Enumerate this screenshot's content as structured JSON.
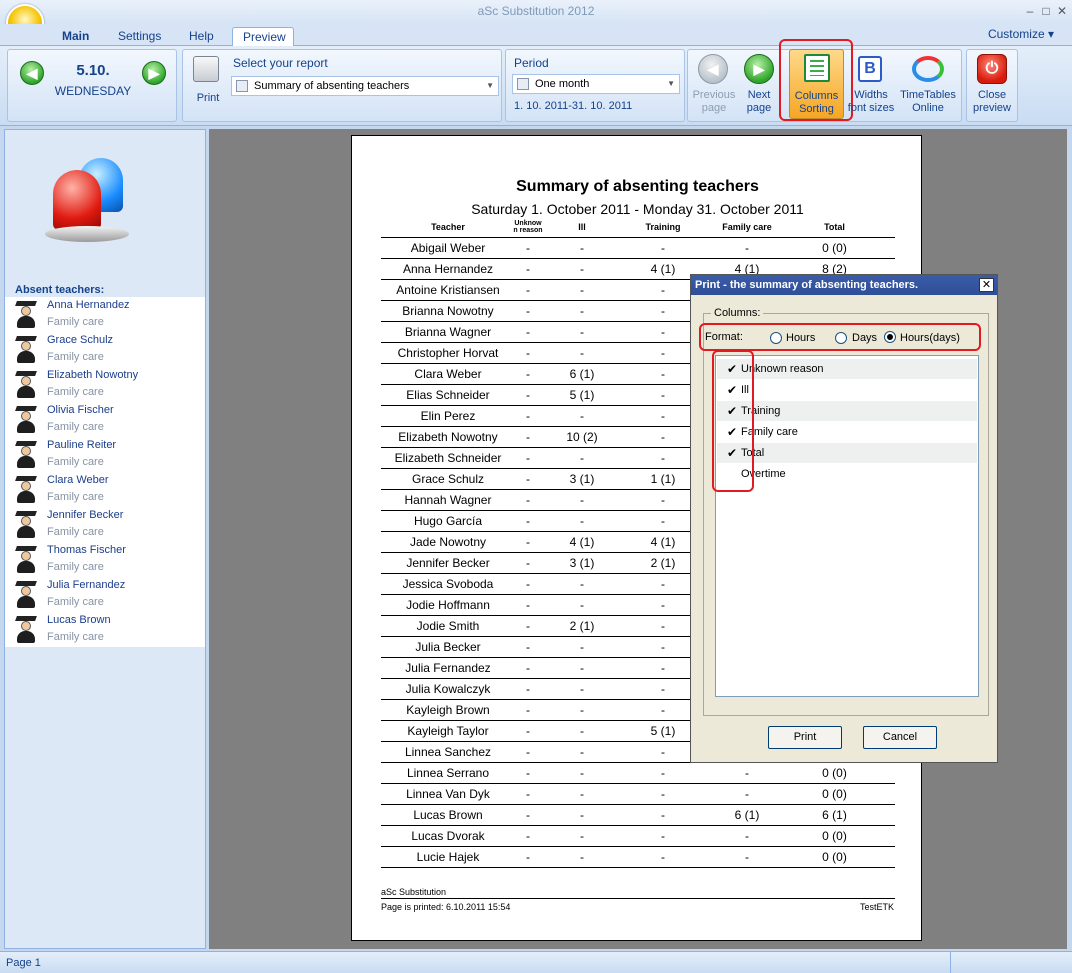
{
  "window": {
    "title": "aSc Substitution 2012"
  },
  "tabs": [
    "Main",
    "Settings",
    "Help",
    "Preview"
  ],
  "customize_label": "Customize",
  "date": {
    "day": "5.10.",
    "weekday": "WEDNESDAY"
  },
  "ribbon": {
    "print_label": "Print",
    "report_label": "Select your report",
    "report_value": "Summary of absenting teachers",
    "period_label": "Period",
    "period_value": "One month",
    "period_range": "1. 10. 2011-31. 10. 2011",
    "prev_page": [
      "Previous",
      "page"
    ],
    "next_page": [
      "Next",
      "page"
    ],
    "columns_sorting": [
      "Columns",
      "Sorting"
    ],
    "widths": [
      "Widths",
      "font sizes"
    ],
    "timetables": [
      "TimeTables",
      "Online"
    ],
    "close_preview": [
      "Close",
      "preview"
    ]
  },
  "absent": {
    "title": "Absent teachers:",
    "items": [
      {
        "name": "Anna Hernandez",
        "reason": "Family care"
      },
      {
        "name": "Grace Schulz",
        "reason": "Family care"
      },
      {
        "name": "Elizabeth Nowotny",
        "reason": "Family care"
      },
      {
        "name": "Olivia Fischer",
        "reason": "Family care"
      },
      {
        "name": "Pauline Reiter",
        "reason": "Family care"
      },
      {
        "name": "Clara Weber",
        "reason": "Family care"
      },
      {
        "name": "Jennifer Becker",
        "reason": "Family care"
      },
      {
        "name": "Thomas Fischer",
        "reason": "Family care"
      },
      {
        "name": "Julia Fernandez",
        "reason": "Family care"
      },
      {
        "name": "Lucas Brown",
        "reason": "Family care"
      }
    ]
  },
  "report": {
    "title": "Summary of absenting teachers",
    "subtitle": "Saturday 1. October 2011 - Monday 31. October 2011",
    "headers": [
      "Teacher",
      "Unknow",
      "n reason",
      "Ill",
      "Training",
      "Family care",
      "Total"
    ],
    "rows": [
      [
        "Abigail Weber",
        "-",
        "-",
        "-",
        "-",
        "0 (0)"
      ],
      [
        "Anna Hernandez",
        "-",
        "-",
        "4 (1)",
        "4 (1)",
        "8 (2)"
      ],
      [
        "Antoine Kristiansen",
        "-",
        "-",
        "-",
        "",
        ""
      ],
      [
        "Brianna Nowotny",
        "-",
        "-",
        "-",
        "",
        ""
      ],
      [
        "Brianna Wagner",
        "-",
        "-",
        "-",
        "",
        ""
      ],
      [
        "Christopher Horvat",
        "-",
        "-",
        "-",
        "",
        ""
      ],
      [
        "Clara Weber",
        "-",
        "6 (1)",
        "-",
        "",
        ""
      ],
      [
        "Elias Schneider",
        "-",
        "5 (1)",
        "-",
        "",
        ""
      ],
      [
        "Elin Perez",
        "-",
        "-",
        "-",
        "",
        ""
      ],
      [
        "Elizabeth Nowotny",
        "-",
        "10 (2)",
        "-",
        "",
        ""
      ],
      [
        "Elizabeth Schneider",
        "-",
        "-",
        "-",
        "",
        ""
      ],
      [
        "Grace Schulz",
        "-",
        "3 (1)",
        "1 (1)",
        "",
        ""
      ],
      [
        "Hannah Wagner",
        "-",
        "-",
        "-",
        "",
        ""
      ],
      [
        "Hugo García",
        "-",
        "-",
        "-",
        "",
        ""
      ],
      [
        "Jade Nowotny",
        "-",
        "4 (1)",
        "4 (1)",
        "",
        ""
      ],
      [
        "Jennifer Becker",
        "-",
        "3 (1)",
        "2 (1)",
        "",
        ""
      ],
      [
        "Jessica Svoboda",
        "-",
        "-",
        "-",
        "",
        ""
      ],
      [
        "Jodie Hoffmann",
        "-",
        "-",
        "-",
        "",
        ""
      ],
      [
        "Jodie Smith",
        "-",
        "2 (1)",
        "-",
        "",
        ""
      ],
      [
        "Julia Becker",
        "-",
        "-",
        "-",
        "",
        ""
      ],
      [
        "Julia Fernandez",
        "-",
        "-",
        "-",
        "",
        ""
      ],
      [
        "Julia Kowalczyk",
        "-",
        "-",
        "-",
        "",
        ""
      ],
      [
        "Kayleigh Brown",
        "-",
        "-",
        "-",
        "",
        ""
      ],
      [
        "Kayleigh Taylor",
        "-",
        "-",
        "5 (1)",
        "",
        ""
      ],
      [
        "Linnea Sanchez",
        "-",
        "-",
        "-",
        "",
        ""
      ],
      [
        "Linnea Serrano",
        "-",
        "-",
        "-",
        "-",
        "0 (0)"
      ],
      [
        "Linnea Van Dyk",
        "-",
        "-",
        "-",
        "-",
        "0 (0)"
      ],
      [
        "Lucas Brown",
        "-",
        "-",
        "-",
        "6 (1)",
        "6 (1)"
      ],
      [
        "Lucas Dvorak",
        "-",
        "-",
        "-",
        "-",
        "0 (0)"
      ],
      [
        "Lucie Hajek",
        "-",
        "-",
        "-",
        "-",
        "0 (0)"
      ]
    ],
    "footer_app": "aSc Substitution",
    "footer_printed": "Page is printed: 6.10.2011 15:54",
    "footer_right": "TestETK"
  },
  "dialog": {
    "title": "Print - the summary of absenting teachers.",
    "columns_label": "Columns:",
    "format_label": "Format:",
    "format_options": [
      "Hours",
      "Days",
      "Hours(days)"
    ],
    "format_selected": "Hours(days)",
    "columns": [
      {
        "label": "Unknown reason",
        "checked": true
      },
      {
        "label": "Ill",
        "checked": true
      },
      {
        "label": "Training",
        "checked": true
      },
      {
        "label": "Family care",
        "checked": true
      },
      {
        "label": "Total",
        "checked": true
      },
      {
        "label": "Overtime",
        "checked": false
      }
    ],
    "print_button": "Print",
    "cancel_button": "Cancel"
  },
  "status": {
    "page": "Page 1"
  }
}
